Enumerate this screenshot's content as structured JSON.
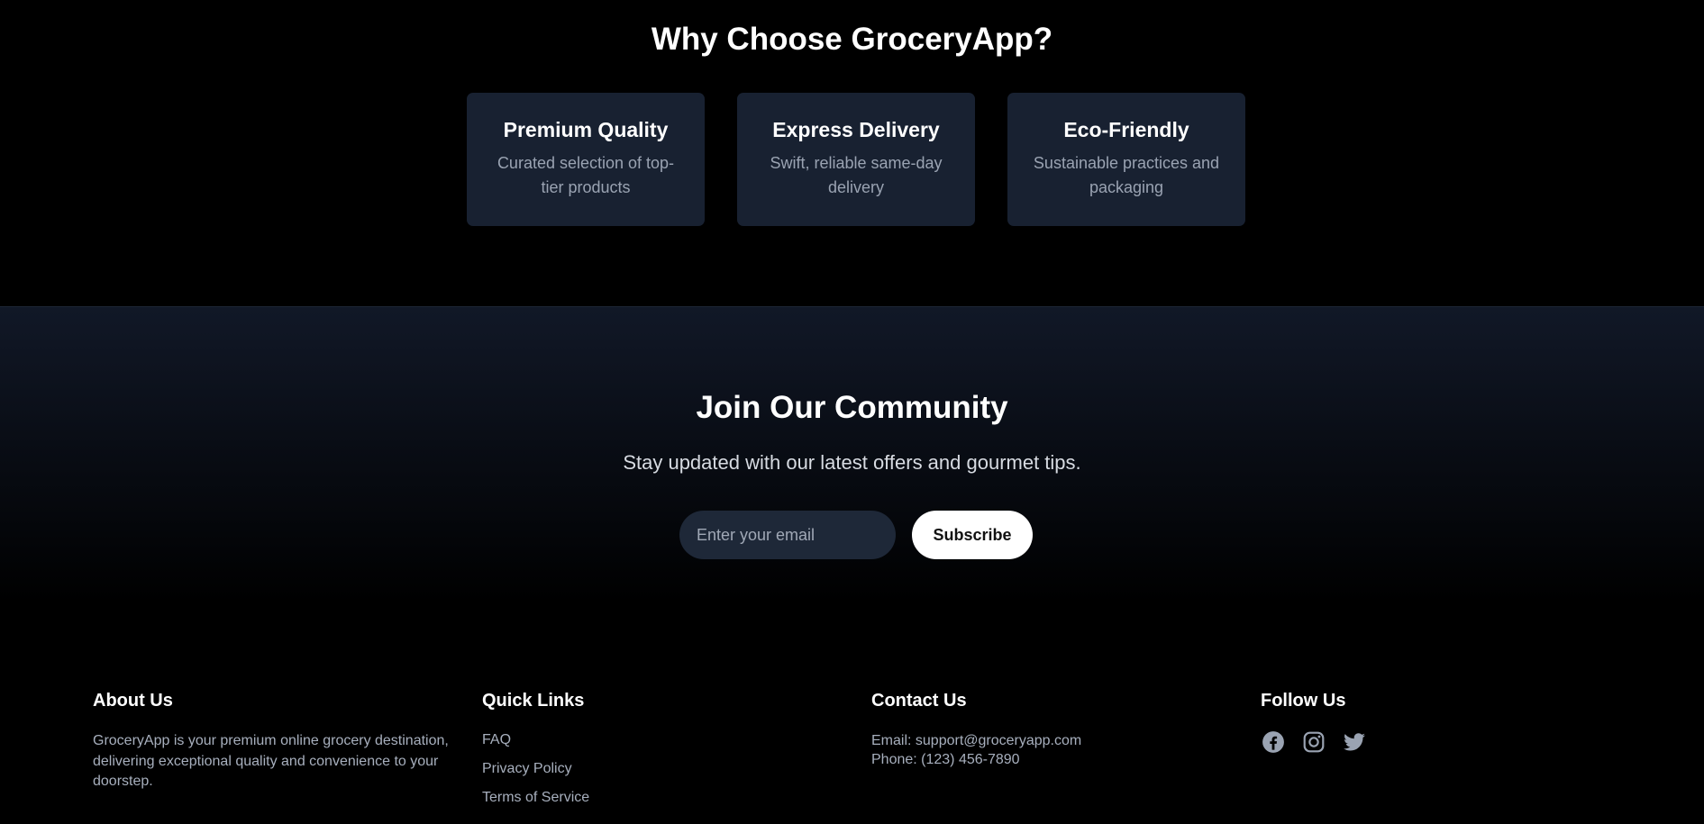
{
  "why": {
    "title": "Why Choose GroceryApp?",
    "features": [
      {
        "title": "Premium Quality",
        "desc": "Curated selection of top-tier products"
      },
      {
        "title": "Express Delivery",
        "desc": "Swift, reliable same-day delivery"
      },
      {
        "title": "Eco-Friendly",
        "desc": "Sustainable practices and packaging"
      }
    ]
  },
  "community": {
    "title": "Join Our Community",
    "subtitle": "Stay updated with our latest offers and gourmet tips.",
    "email_placeholder": "Enter your email",
    "subscribe_label": "Subscribe"
  },
  "footer": {
    "about": {
      "heading": "About Us",
      "text": "GroceryApp is your premium online grocery destination, delivering exceptional quality and convenience to your doorstep."
    },
    "quick_links": {
      "heading": "Quick Links",
      "items": [
        "FAQ",
        "Privacy Policy",
        "Terms of Service"
      ]
    },
    "contact": {
      "heading": "Contact Us",
      "email": "Email: support@groceryapp.com",
      "phone": "Phone: (123) 456-7890"
    },
    "follow": {
      "heading": "Follow Us",
      "icons": [
        "facebook-icon",
        "instagram-icon",
        "twitter-icon"
      ]
    }
  },
  "colors": {
    "background": "#000000",
    "card": "#182131",
    "muted_text": "#a7afbd",
    "input_bg": "#1e2838",
    "button_bg": "#ffffff"
  }
}
